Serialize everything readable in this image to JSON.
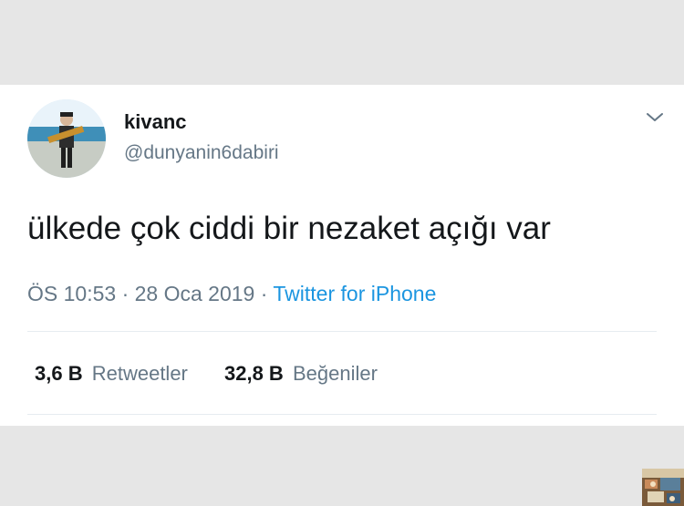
{
  "tweet": {
    "author": {
      "display_name": "kivanc",
      "handle": "@dunyanin6dabiri"
    },
    "text": "ülkede çok ciddi bir nezaket açığı var",
    "time": "ÖS 10:53",
    "date": "28 Oca 2019",
    "separator": "·",
    "source": "Twitter for iPhone",
    "stats": {
      "retweets_count": "3,6 B",
      "retweets_label": "Retweetler",
      "likes_count": "32,8 B",
      "likes_label": "Beğeniler"
    }
  },
  "colors": {
    "text_primary": "#14171a",
    "text_secondary": "#657786",
    "link": "#1b95e0",
    "divider": "#e6ecf0",
    "page_background": "#e6e6e6"
  },
  "icons": {
    "menu": "chevron-down-icon"
  }
}
